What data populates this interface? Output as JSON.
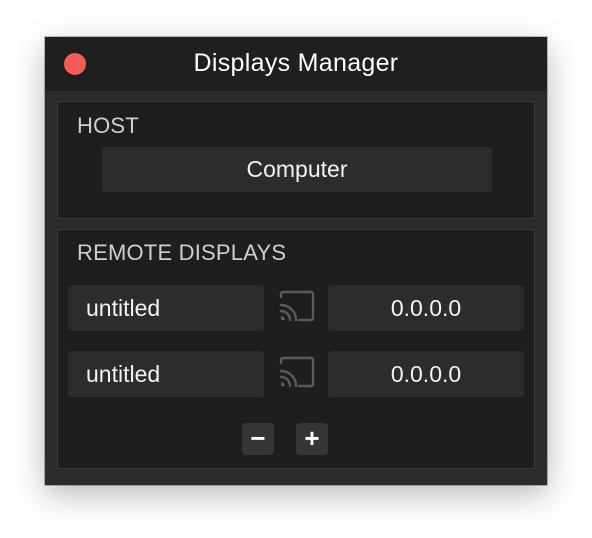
{
  "window": {
    "title": "Displays Manager"
  },
  "host": {
    "section_label": "HOST",
    "selected_host": "Computer"
  },
  "remote": {
    "section_label": "REMOTE DISPLAYS",
    "displays": [
      {
        "name": "untitled",
        "ip": "0.0.0.0"
      },
      {
        "name": "untitled",
        "ip": "0.0.0.0"
      }
    ],
    "remove_label": "−",
    "add_label": "+"
  },
  "icons": {
    "close": "close-icon",
    "cast": "cast-icon"
  },
  "colors": {
    "close_red": "#f25c58",
    "window_bg": "#2b2b2b",
    "panel_bg": "#1e1e1e",
    "field_bg": "#2c2c2c",
    "text": "#f2f2f2",
    "label": "#cfcfcf"
  }
}
